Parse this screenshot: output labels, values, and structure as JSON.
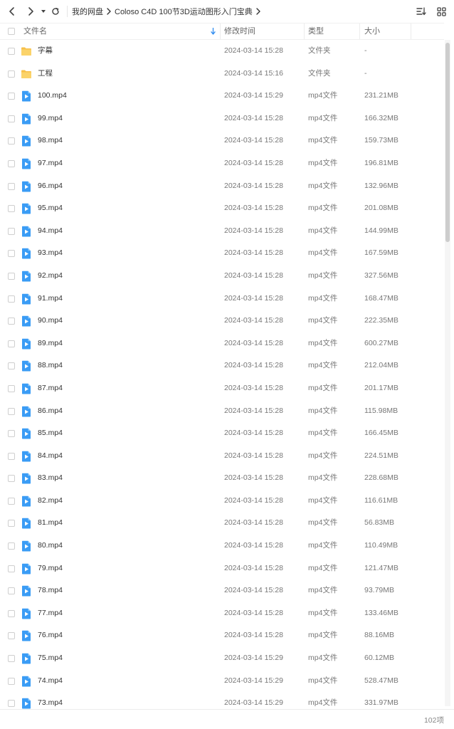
{
  "breadcrumb": [
    "我的网盘",
    "Coloso C4D 100节3D运动图形入门宝典"
  ],
  "header": {
    "name": "文件名",
    "mtime": "修改时间",
    "type": "类型",
    "size": "大小"
  },
  "icons": {
    "back": "chevron-left-icon",
    "forward": "chevron-right-icon",
    "dropdown": "caret-down-icon",
    "refresh": "refresh-icon",
    "sort": "sort-icon",
    "grid_view": "grid-view-icon",
    "folder": "folder-icon",
    "video": "video-file-icon"
  },
  "colors": {
    "folder": "#f7c04a",
    "video": "#3a9cf5",
    "sort_arrow": "#2f8cf0"
  },
  "files": [
    {
      "kind": "folder",
      "name": "字幕",
      "mtime": "2024-03-14 15:28",
      "type": "文件夹",
      "size": "-"
    },
    {
      "kind": "folder",
      "name": "工程",
      "mtime": "2024-03-14 15:16",
      "type": "文件夹",
      "size": "-"
    },
    {
      "kind": "video",
      "name": "100.mp4",
      "mtime": "2024-03-14 15:29",
      "type": "mp4文件",
      "size": "231.21MB"
    },
    {
      "kind": "video",
      "name": "99.mp4",
      "mtime": "2024-03-14 15:28",
      "type": "mp4文件",
      "size": "166.32MB"
    },
    {
      "kind": "video",
      "name": "98.mp4",
      "mtime": "2024-03-14 15:28",
      "type": "mp4文件",
      "size": "159.73MB"
    },
    {
      "kind": "video",
      "name": "97.mp4",
      "mtime": "2024-03-14 15:28",
      "type": "mp4文件",
      "size": "196.81MB"
    },
    {
      "kind": "video",
      "name": "96.mp4",
      "mtime": "2024-03-14 15:28",
      "type": "mp4文件",
      "size": "132.96MB"
    },
    {
      "kind": "video",
      "name": "95.mp4",
      "mtime": "2024-03-14 15:28",
      "type": "mp4文件",
      "size": "201.08MB"
    },
    {
      "kind": "video",
      "name": "94.mp4",
      "mtime": "2024-03-14 15:28",
      "type": "mp4文件",
      "size": "144.99MB"
    },
    {
      "kind": "video",
      "name": "93.mp4",
      "mtime": "2024-03-14 15:28",
      "type": "mp4文件",
      "size": "167.59MB"
    },
    {
      "kind": "video",
      "name": "92.mp4",
      "mtime": "2024-03-14 15:28",
      "type": "mp4文件",
      "size": "327.56MB"
    },
    {
      "kind": "video",
      "name": "91.mp4",
      "mtime": "2024-03-14 15:28",
      "type": "mp4文件",
      "size": "168.47MB"
    },
    {
      "kind": "video",
      "name": "90.mp4",
      "mtime": "2024-03-14 15:28",
      "type": "mp4文件",
      "size": "222.35MB"
    },
    {
      "kind": "video",
      "name": "89.mp4",
      "mtime": "2024-03-14 15:28",
      "type": "mp4文件",
      "size": "600.27MB"
    },
    {
      "kind": "video",
      "name": "88.mp4",
      "mtime": "2024-03-14 15:28",
      "type": "mp4文件",
      "size": "212.04MB"
    },
    {
      "kind": "video",
      "name": "87.mp4",
      "mtime": "2024-03-14 15:28",
      "type": "mp4文件",
      "size": "201.17MB"
    },
    {
      "kind": "video",
      "name": "86.mp4",
      "mtime": "2024-03-14 15:28",
      "type": "mp4文件",
      "size": "115.98MB"
    },
    {
      "kind": "video",
      "name": "85.mp4",
      "mtime": "2024-03-14 15:28",
      "type": "mp4文件",
      "size": "166.45MB"
    },
    {
      "kind": "video",
      "name": "84.mp4",
      "mtime": "2024-03-14 15:28",
      "type": "mp4文件",
      "size": "224.51MB"
    },
    {
      "kind": "video",
      "name": "83.mp4",
      "mtime": "2024-03-14 15:28",
      "type": "mp4文件",
      "size": "228.68MB"
    },
    {
      "kind": "video",
      "name": "82.mp4",
      "mtime": "2024-03-14 15:28",
      "type": "mp4文件",
      "size": "116.61MB"
    },
    {
      "kind": "video",
      "name": "81.mp4",
      "mtime": "2024-03-14 15:28",
      "type": "mp4文件",
      "size": "56.83MB"
    },
    {
      "kind": "video",
      "name": "80.mp4",
      "mtime": "2024-03-14 15:28",
      "type": "mp4文件",
      "size": "110.49MB"
    },
    {
      "kind": "video",
      "name": "79.mp4",
      "mtime": "2024-03-14 15:28",
      "type": "mp4文件",
      "size": "121.47MB"
    },
    {
      "kind": "video",
      "name": "78.mp4",
      "mtime": "2024-03-14 15:28",
      "type": "mp4文件",
      "size": "93.79MB"
    },
    {
      "kind": "video",
      "name": "77.mp4",
      "mtime": "2024-03-14 15:28",
      "type": "mp4文件",
      "size": "133.46MB"
    },
    {
      "kind": "video",
      "name": "76.mp4",
      "mtime": "2024-03-14 15:28",
      "type": "mp4文件",
      "size": "88.16MB"
    },
    {
      "kind": "video",
      "name": "75.mp4",
      "mtime": "2024-03-14 15:29",
      "type": "mp4文件",
      "size": "60.12MB"
    },
    {
      "kind": "video",
      "name": "74.mp4",
      "mtime": "2024-03-14 15:29",
      "type": "mp4文件",
      "size": "528.47MB"
    },
    {
      "kind": "video",
      "name": "73.mp4",
      "mtime": "2024-03-14 15:29",
      "type": "mp4文件",
      "size": "331.97MB"
    }
  ],
  "footer": {
    "item_count": "102项"
  }
}
